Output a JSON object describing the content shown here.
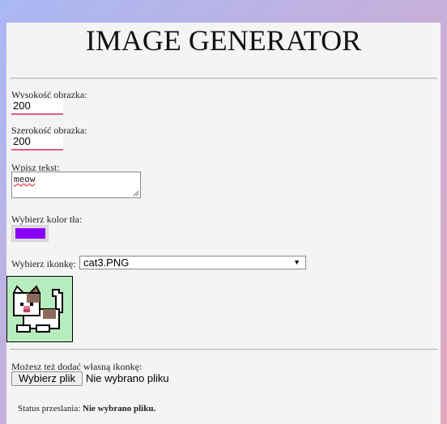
{
  "page": {
    "title": "IMAGE GENERATOR"
  },
  "form": {
    "height_label": "Wysokość obrazka:",
    "height_value": "200",
    "width_label": "Szerokość obrazka:",
    "width_value": "200",
    "text_label": "Wpisz tekst:",
    "text_value": "meow",
    "bg_color_label": "Wybierz kolor tła:",
    "bg_color_value": "#8a00ff",
    "icon_label": "Wybierz ikonkę:",
    "icon_selected": "cat3.PNG",
    "icon_preview_name": "cat-icon"
  },
  "upload": {
    "label": "Możesz też dodać własną ikonkę:",
    "button_label": "Wybierz plik",
    "file_status": "Nie wybrano pliku",
    "status_prefix": "Status przeslania:",
    "status_value": "Nie wybrano pliku."
  },
  "colors": {
    "input_underline": "#e05a8c",
    "preview_bg": "#b7ecbe"
  }
}
